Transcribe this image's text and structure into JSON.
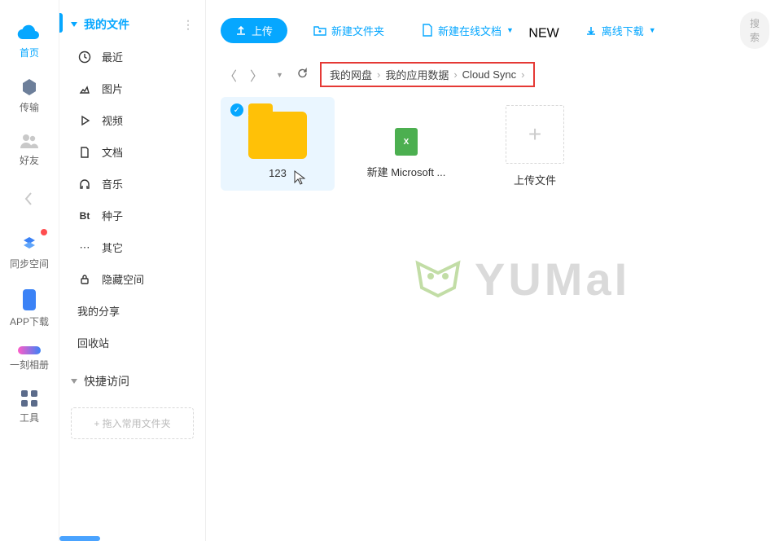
{
  "leftbar": [
    {
      "name": "home",
      "label": "首页",
      "active": true
    },
    {
      "name": "transfer",
      "label": "传输"
    },
    {
      "name": "friends",
      "label": "好友"
    },
    {
      "name": "sync",
      "label": "同步空间"
    },
    {
      "name": "app-download",
      "label": "APP下载"
    },
    {
      "name": "album",
      "label": "一刻相册"
    },
    {
      "name": "tools",
      "label": "工具"
    }
  ],
  "sidebar": {
    "my_files_label": "我的文件",
    "items": [
      {
        "name": "recent",
        "label": "最近"
      },
      {
        "name": "pictures",
        "label": "图片"
      },
      {
        "name": "videos",
        "label": "视频"
      },
      {
        "name": "docs",
        "label": "文档"
      },
      {
        "name": "music",
        "label": "音乐"
      },
      {
        "name": "bt",
        "label": "种子",
        "icon_text": "Bt"
      },
      {
        "name": "other",
        "label": "其它"
      },
      {
        "name": "hidden",
        "label": "隐藏空间"
      }
    ],
    "my_share": "我的分享",
    "recycle": "回收站",
    "quick_access": "快捷访问",
    "drag_hint": "+ 拖入常用文件夹"
  },
  "toolbar": {
    "upload": "上传",
    "new_folder": "新建文件夹",
    "new_online_doc": "新建在线文档",
    "offline_download": "离线下载",
    "new_badge": "NEW",
    "search_placeholder": "搜索"
  },
  "breadcrumbs": [
    "我的网盘",
    "我的应用数据",
    "Cloud Sync"
  ],
  "files": [
    {
      "name": "folder-123",
      "label": "123",
      "type": "folder",
      "selected": true
    },
    {
      "name": "xls-file",
      "label": "新建 Microsoft ...",
      "type": "xls"
    },
    {
      "name": "upload-tile",
      "label": "上传文件",
      "type": "upload"
    }
  ],
  "watermark_text": "YUMaI"
}
